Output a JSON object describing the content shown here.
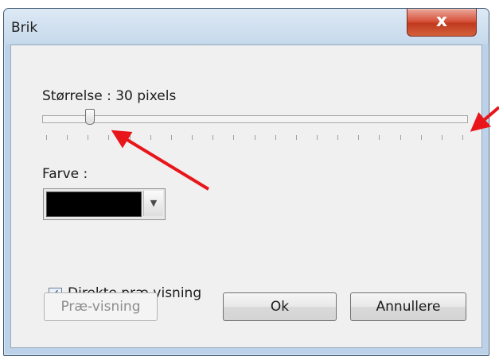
{
  "dialog": {
    "title": "Brik",
    "close_label": "x"
  },
  "size": {
    "label": "Størrelse : 30 pixels",
    "slider_fraction": 0.11
  },
  "color": {
    "label": "Farve :",
    "selected_color": "#000000"
  },
  "preview": {
    "checkbox_label": "Direkte præ-visning",
    "checked": true,
    "preview_button": "Præ-visning"
  },
  "buttons": {
    "ok": "Ok",
    "cancel": "Annullere"
  },
  "annotations": {
    "arrow_color": "#e8161a"
  },
  "icons": {
    "close": "close-icon",
    "dropdown": "chevron-down-icon",
    "check": "check-icon"
  }
}
